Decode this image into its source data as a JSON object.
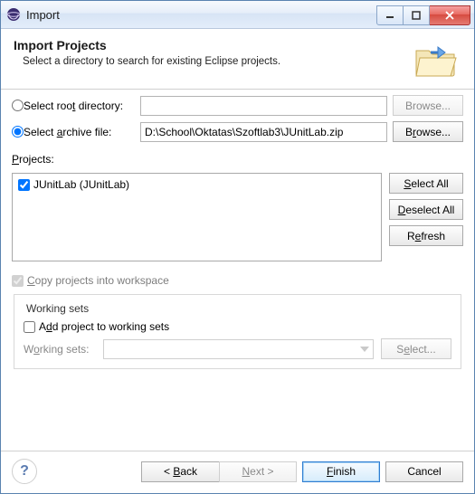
{
  "window": {
    "title": "Import"
  },
  "header": {
    "title": "Import Projects",
    "subtitle": "Select a directory to search for existing Eclipse projects."
  },
  "source": {
    "root_radio_label_pre": "Select roo",
    "root_radio_label_u": "t",
    "root_radio_label_post": " directory:",
    "root_value": "",
    "root_browse": "Browse...",
    "archive_radio_label_pre": "Select ",
    "archive_radio_label_u": "a",
    "archive_radio_label_post": "rchive file:",
    "archive_value": "D:\\School\\Oktatas\\Szoftlab3\\JUnitLab.zip",
    "archive_browse_pre": "B",
    "archive_browse_u": "r",
    "archive_browse_post": "owse..."
  },
  "projects": {
    "label_u": "P",
    "label_post": "rojects:",
    "items": [
      {
        "checked": true,
        "label": "JUnitLab (JUnitLab)"
      }
    ],
    "select_all": "Select All",
    "deselect_all": "Deselect All",
    "refresh": "Refresh"
  },
  "copy": {
    "label_u": "C",
    "label_post": "opy projects into workspace"
  },
  "workingsets": {
    "group_title": "Working sets",
    "add_label_pre": "A",
    "add_label_u": "d",
    "add_label_post": "d project to working sets",
    "field_label_pre": "W",
    "field_label_u": "o",
    "field_label_post": "rking sets:",
    "select_btn_pre": "S",
    "select_btn_u": "e",
    "select_btn_post": "lect..."
  },
  "footer": {
    "back": "< Back",
    "next": "Next >",
    "finish": "Finish",
    "cancel": "Cancel"
  }
}
